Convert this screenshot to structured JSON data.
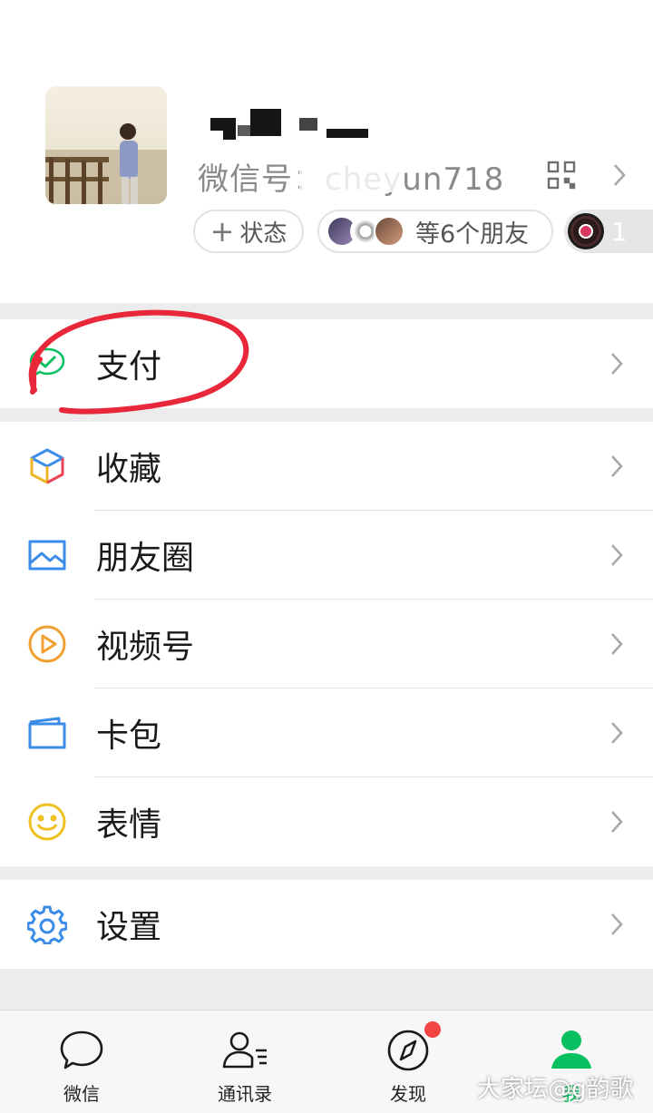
{
  "profile": {
    "wechat_id": "微信号：cheyun718",
    "status_label": "状态",
    "friends_label": "等6个朋友",
    "music_count": "1"
  },
  "menu": {
    "pay": "支付",
    "favorites": "收藏",
    "moments": "朋友圈",
    "channels": "视频号",
    "cards": "卡包",
    "stickers": "表情",
    "settings": "设置"
  },
  "tabbar": {
    "chats": "微信",
    "contacts": "通讯录",
    "discover": "发现",
    "me": "我"
  },
  "watermark": "大家坛@g韵歌",
  "colors": {
    "accent_green": "#07c160",
    "badge_red": "#f44545",
    "annotation_red": "#e8283a"
  }
}
